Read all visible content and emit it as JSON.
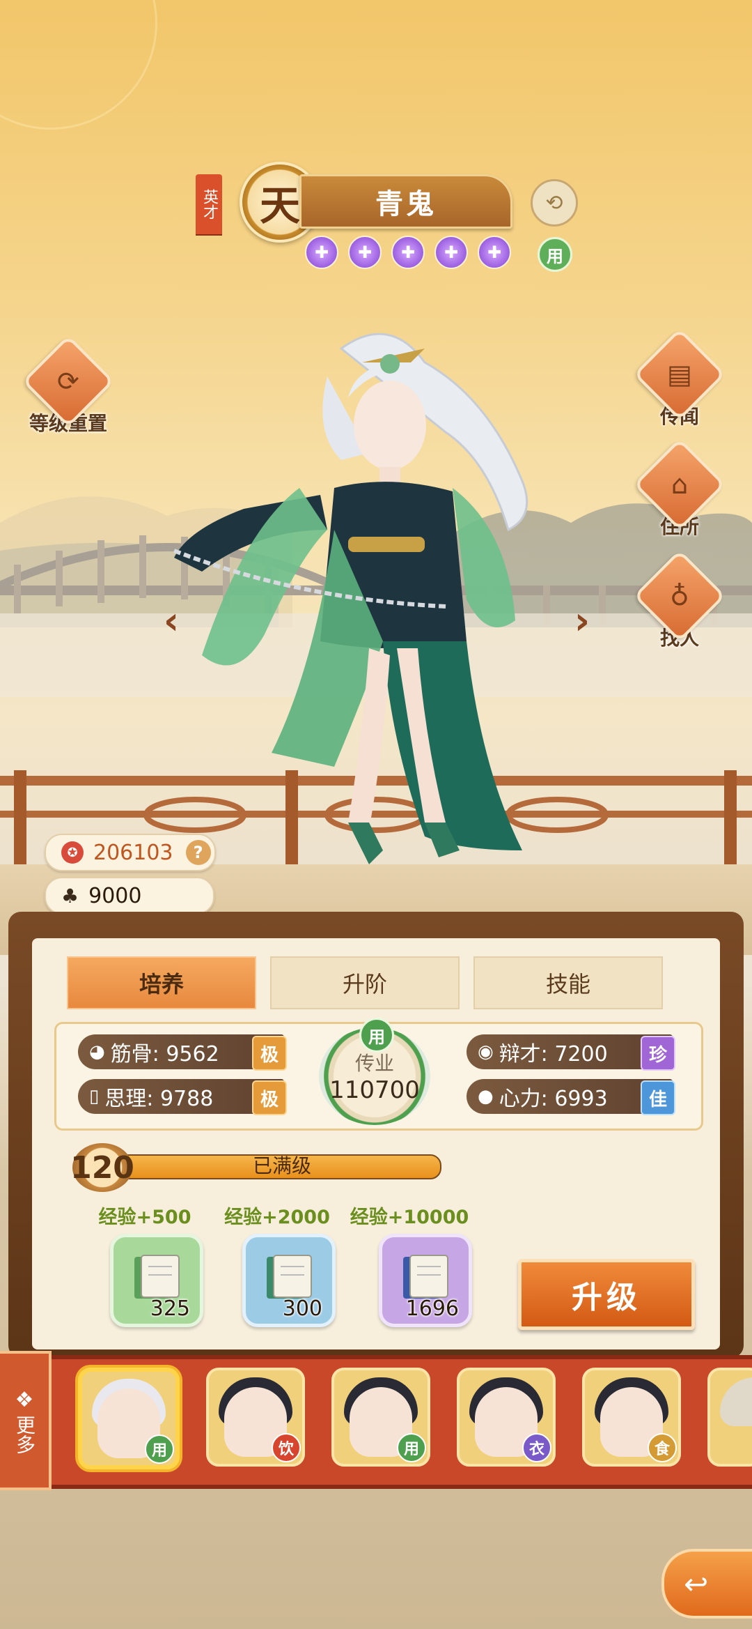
{
  "header": {
    "talent_tag": "英才",
    "rank_char": "天",
    "character_name": "青鬼",
    "star_count": 5,
    "status_badge": "用"
  },
  "side_left": [
    {
      "label": "等级重置",
      "icon": "reset-icon"
    }
  ],
  "side_right": [
    {
      "label": "传闻",
      "icon": "scroll-icon"
    },
    {
      "label": "住所",
      "icon": "house-icon"
    },
    {
      "label": "找人",
      "icon": "search-person-icon"
    }
  ],
  "currency": {
    "coins": "206103",
    "population": "9000"
  },
  "tabs": [
    "培养",
    "升阶",
    "技能"
  ],
  "active_tab": 0,
  "stats": {
    "jingu": {
      "label": "筋骨: 9562",
      "grade": "极"
    },
    "sili": {
      "label": "思理: 9788",
      "grade": "极"
    },
    "biancai": {
      "label": "辩才: 7200",
      "grade": "珍"
    },
    "xinli": {
      "label": "心力: 6993",
      "grade": "佳"
    }
  },
  "legacy": {
    "badge": "用",
    "title": "传业",
    "value": "110700"
  },
  "level": {
    "value": "120",
    "status": "已满级",
    "progress": 1.0
  },
  "exp_items": [
    {
      "label": "经验+500",
      "count": "325",
      "color": "green"
    },
    {
      "label": "经验+2000",
      "count": "300",
      "color": "blue"
    },
    {
      "label": "经验+10000",
      "count": "1696",
      "color": "purple"
    }
  ],
  "upgrade_button": "升级",
  "more_button": "更多",
  "roster": [
    {
      "role": "用",
      "hair": "#e8e8ee",
      "selected": true
    },
    {
      "role": "饮",
      "hair": "#2a2a35"
    },
    {
      "role": "用",
      "hair": "#2a2a35"
    },
    {
      "role": "衣",
      "hair": "#2a2a35"
    },
    {
      "role": "食",
      "hair": "#2a2a35"
    }
  ]
}
